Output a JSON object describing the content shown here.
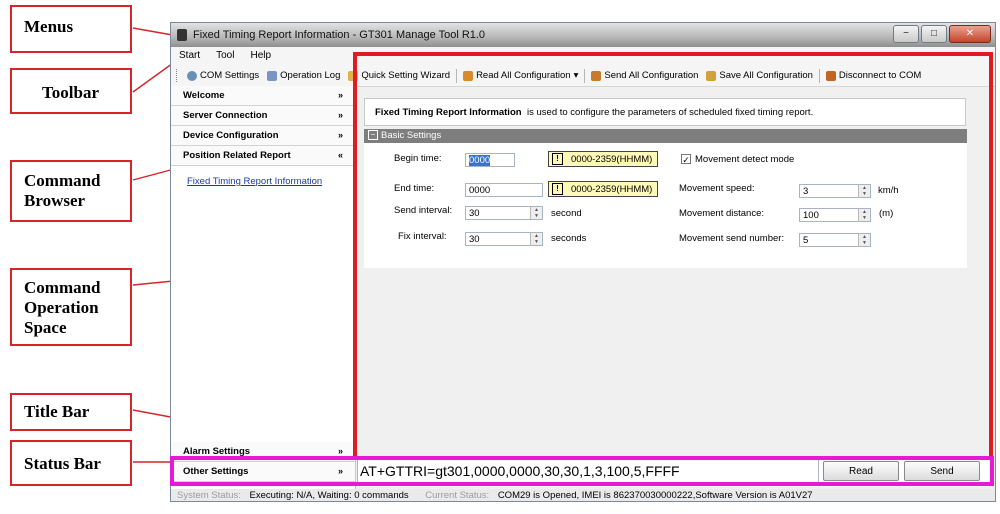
{
  "callouts": {
    "menus": "Menus",
    "toolbar": "Toolbar",
    "command_browser": [
      "Command",
      "Browser"
    ],
    "command_operation_space": [
      "Command",
      "Operation",
      "Space"
    ],
    "title_bar": "Title Bar",
    "status_bar": "Status Bar"
  },
  "window": {
    "title": "Fixed Timing Report Information - GT301 Manage Tool R1.0",
    "controls": {
      "minimize": "−",
      "maximize": "□",
      "close": "✕"
    }
  },
  "menubar": [
    "Start",
    "Tool",
    "Help"
  ],
  "toolbar": {
    "items": [
      {
        "label": "COM Settings",
        "icon": "gear-icon",
        "color": "#6a8fb8"
      },
      {
        "label": "Operation Log",
        "icon": "log-icon",
        "color": "#7c94c4"
      },
      {
        "label": "Quick Setting Wizard",
        "icon": "wizard-icon",
        "color": "#e0b24a"
      },
      {
        "label": "Read All Configuration",
        "icon": "read-icon",
        "color": "#d98b2a",
        "dropdown": "▾"
      },
      {
        "label": "Send All Configuration",
        "icon": "send-icon",
        "color": "#c77a2a"
      },
      {
        "label": "Save All Configuration",
        "icon": "save-icon",
        "color": "#d2a03a"
      },
      {
        "label": "Disconnect to COM",
        "icon": "disconnect-icon",
        "color": "#c0641f"
      }
    ]
  },
  "browser": {
    "sections": [
      {
        "label": "Welcome",
        "chevron": "»"
      },
      {
        "label": "Server Connection",
        "chevron": "»"
      },
      {
        "label": "Device Configuration",
        "chevron": "»"
      },
      {
        "label": "Position Related Report",
        "chevron": "«"
      }
    ],
    "active_link": "Fixed Timing Report Information",
    "bottom_sections": [
      {
        "label": "Alarm Settings",
        "chevron": "»"
      },
      {
        "label": "Other Settings",
        "chevron": "»"
      }
    ]
  },
  "main": {
    "description_title": "Fixed Timing Report Information",
    "description_text": "is used to configure the parameters of scheduled fixed timing report.",
    "basic_settings": {
      "header": "Basic Settings",
      "begin_time": {
        "label": "Begin time:",
        "value": "0000",
        "hint": "0000-2359(HHMM)"
      },
      "end_time": {
        "label": "End time:",
        "value": "0000",
        "hint": "0000-2359(HHMM)"
      },
      "send_interval": {
        "label": "Send interval:",
        "value": "30",
        "unit": "second"
      },
      "fix_interval": {
        "label": "Fix interval:",
        "value": "30",
        "unit": "seconds"
      },
      "movement_detect_mode": {
        "label": "Movement detect mode",
        "checked": true
      },
      "movement_speed": {
        "label": "Movement speed:",
        "value": "3",
        "unit": "km/h"
      },
      "movement_distance": {
        "label": "Movement distance:",
        "value": "100",
        "unit": "(m)"
      },
      "movement_send_number": {
        "label": "Movement send number:",
        "value": "5"
      }
    }
  },
  "command_bar": {
    "command": "AT+GTTRI=gt301,0000,0000,30,30,1,3,100,5,FFFF",
    "read_label": "Read",
    "send_label": "Send"
  },
  "status_bar": {
    "system_status_label": "System Status:",
    "system_status_value": "Executing: N/A, Waiting: 0 commands",
    "current_status_label": "Current Status:",
    "current_status_value": "COM29 is Opened, IMEI is 862370030000222,Software Version is A01V27"
  },
  "colors": {
    "red_frame": "#e11b22",
    "magenta_frame": "#e31bd6",
    "callout_border": "#d9232b"
  }
}
